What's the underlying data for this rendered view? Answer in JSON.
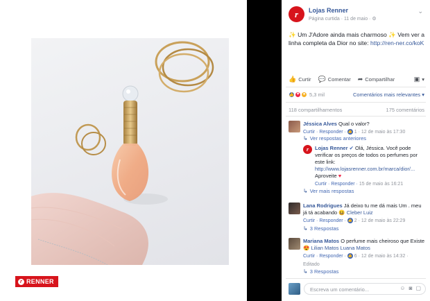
{
  "brand_badge": "RENNER",
  "post": {
    "page_name": "Lojas Renner",
    "subtitle": "Página curtida · 11 de maio ·",
    "text_a": "Um J'Adore ainda mais charmoso",
    "text_b": "Vem ver a linha completa da Dior no site:",
    "link": "http://ren-ner.co/koK",
    "avatar_letter": "r"
  },
  "actions": {
    "like": "Curtir",
    "comment": "Comentar",
    "share": "Compartilhar"
  },
  "reactions": {
    "count": "5,3 mil",
    "sort": "Comentários mais relevantes"
  },
  "counts": {
    "shares": "118 compartilhamentos",
    "comments": "175 comentários"
  },
  "comments": [
    {
      "name": "Jéssica Alves",
      "text": "Qual o valor?",
      "actions": "Curtir · Responder ·",
      "likes": "1",
      "time": "· 12 de maio às 17:30",
      "more": "Ver respostas anteriores"
    },
    {
      "name": "Lana Rodrigues",
      "text": "Já deixo tu me dá mais Um . meu já tá acabando",
      "tag": "Cleber Luiz",
      "actions": "Curtir · Responder ·",
      "likes": "2",
      "time": "· 12 de maio às 22:29",
      "more": "3 Respostas"
    },
    {
      "name": "Mariana Matos",
      "text": "O perfume mais cheiroso que Existe",
      "tag": "Lilian Matos Luana Matos",
      "actions": "Curtir · Responder ·",
      "likes": "6",
      "time": "· 12 de maio às 14:32 ·",
      "edited": "Editado",
      "more": "3 Respostas"
    }
  ],
  "reply": {
    "name": "Lojas Renner",
    "text": "Olá, Jéssica. Você pode verificar os preços de todos os perfumes por este link:",
    "link": "http://www.lojasrenner.com.br/marca/dior/...",
    "sign": "Aproveite",
    "actions": "Curtir · Responder ·",
    "time": "15 de maio às 16:21",
    "more": "Ver mais respostas"
  },
  "write": {
    "placeholder": "Escreva um comentário..."
  },
  "colors": {
    "brand_red": "#d7141c",
    "fb_link": "#365899",
    "meta_gray": "#90949c"
  }
}
